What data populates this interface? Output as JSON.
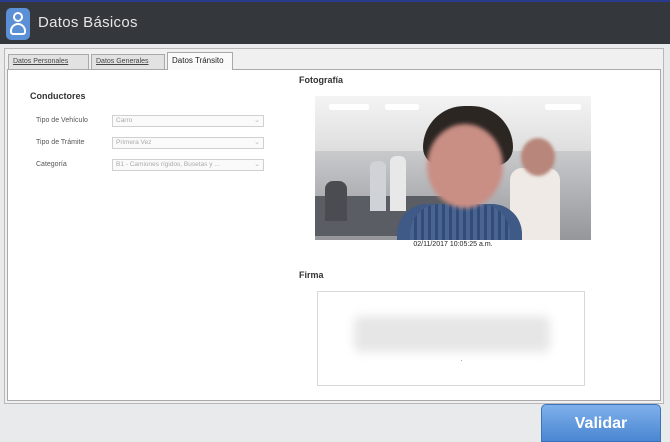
{
  "window": {
    "title": "Datos Básicos"
  },
  "tabs": [
    {
      "label": "Datos Personales"
    },
    {
      "label": "Datos Generales"
    },
    {
      "label": "Datos Tránsito"
    }
  ],
  "conductores": {
    "heading": "Conductores",
    "fields": [
      {
        "label": "Tipo de Vehículo",
        "value": "Carro"
      },
      {
        "label": "Tipo de Trámite",
        "value": "Primera Vez"
      },
      {
        "label": "Categoría",
        "value": "B1 - Camiones rígidos, Busetas y ..."
      }
    ]
  },
  "fotografia": {
    "heading": "Fotografía",
    "timestamp": "02/11/2017 10:05:25 a.m."
  },
  "firma": {
    "heading": "Firma"
  },
  "actions": {
    "validar_label": "Validar"
  },
  "colors": {
    "titlebar": "#34373c",
    "accent": "#4a86d2"
  }
}
